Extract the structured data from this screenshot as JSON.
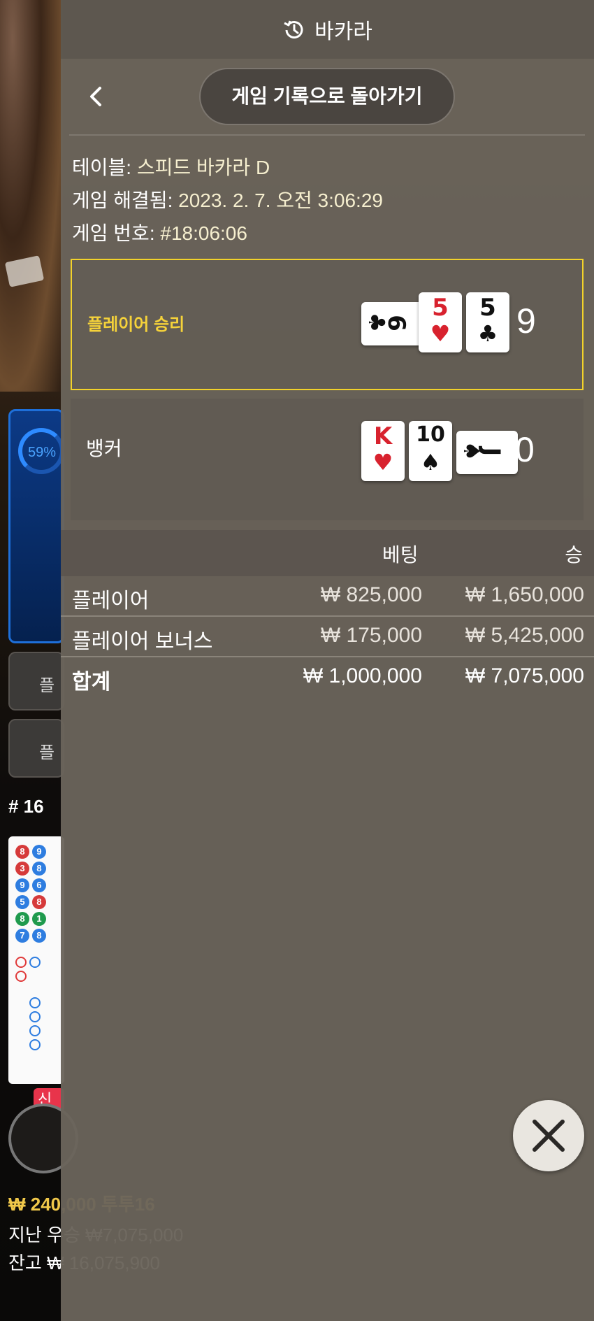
{
  "background": {
    "stat_percent": "59%",
    "side_button_1": "플",
    "side_button_2": "플",
    "round_label": "# 16",
    "new_badge": "신규",
    "balance_line_1": "₩ 240,000 투투16",
    "balance_line_2": "지난 우승 ₩7,075,000",
    "balance_line_3": "잔고 ₩ 16,075,900",
    "roadmap_numbers": [
      "8",
      "9",
      "3",
      "8",
      "9",
      "6",
      "5",
      "8",
      "8",
      "1",
      "7",
      "8"
    ]
  },
  "header": {
    "title": "바카라",
    "history_icon": "history-clock-icon"
  },
  "nav": {
    "back_icon": "chevron-left-icon",
    "history_button": "게임 기록으로 돌아가기"
  },
  "info": {
    "table_label": "테이블:",
    "table_value": "스피드 바카라 D",
    "resolved_label": "게임 해결됨:",
    "resolved_value": "2023. 2. 7. 오전 3:06:29",
    "number_label": "게임 번호:",
    "number_value": "#18:06:06"
  },
  "player": {
    "label": "플레이어 승리",
    "score": "9",
    "cards": [
      {
        "rank": "6",
        "suit": "♣",
        "color": "#111111",
        "orientation": "horizontal"
      },
      {
        "rank": "5",
        "suit": "♥",
        "color": "#d8222e",
        "orientation": "vertical"
      },
      {
        "rank": "5",
        "suit": "♣",
        "color": "#111111",
        "orientation": "vertical"
      }
    ]
  },
  "banker": {
    "label": "뱅커",
    "score": "0",
    "cards": [
      {
        "rank": "K",
        "suit": "♥",
        "color": "#d8222e",
        "orientation": "vertical"
      },
      {
        "rank": "10",
        "suit": "♠",
        "color": "#111111",
        "orientation": "vertical"
      },
      {
        "rank": "J",
        "suit": "♠",
        "color": "#111111",
        "orientation": "horizontal"
      }
    ]
  },
  "bets_table": {
    "col_bet": "베팅",
    "col_win": "승",
    "rows": [
      {
        "name": "플레이어",
        "bet": "₩ 825,000",
        "win": "₩ 1,650,000"
      },
      {
        "name": "플레이어 보너스",
        "bet": "₩ 175,000",
        "win": "₩ 5,425,000"
      }
    ],
    "total": {
      "name": "합계",
      "bet": "₩ 1,000,000",
      "win": "₩ 7,075,000"
    }
  },
  "close": {
    "icon": "close-icon"
  },
  "colors": {
    "win_highlight": "#f2d22a",
    "panel": "#6a645b",
    "red_suit": "#d8222e"
  }
}
